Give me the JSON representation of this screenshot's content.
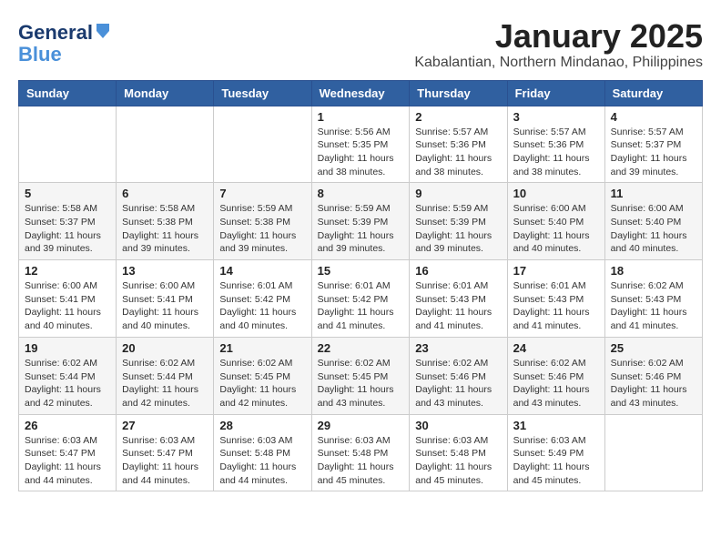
{
  "logo": {
    "line1": "General",
    "line2": "Blue"
  },
  "header": {
    "title": "January 2025",
    "subtitle": "Kabalantian, Northern Mindanao, Philippines"
  },
  "weekdays": [
    "Sunday",
    "Monday",
    "Tuesday",
    "Wednesday",
    "Thursday",
    "Friday",
    "Saturday"
  ],
  "weeks": [
    [
      {
        "day": "",
        "info": ""
      },
      {
        "day": "",
        "info": ""
      },
      {
        "day": "",
        "info": ""
      },
      {
        "day": "1",
        "info": "Sunrise: 5:56 AM\nSunset: 5:35 PM\nDaylight: 11 hours\nand 38 minutes."
      },
      {
        "day": "2",
        "info": "Sunrise: 5:57 AM\nSunset: 5:36 PM\nDaylight: 11 hours\nand 38 minutes."
      },
      {
        "day": "3",
        "info": "Sunrise: 5:57 AM\nSunset: 5:36 PM\nDaylight: 11 hours\nand 38 minutes."
      },
      {
        "day": "4",
        "info": "Sunrise: 5:57 AM\nSunset: 5:37 PM\nDaylight: 11 hours\nand 39 minutes."
      }
    ],
    [
      {
        "day": "5",
        "info": "Sunrise: 5:58 AM\nSunset: 5:37 PM\nDaylight: 11 hours\nand 39 minutes."
      },
      {
        "day": "6",
        "info": "Sunrise: 5:58 AM\nSunset: 5:38 PM\nDaylight: 11 hours\nand 39 minutes."
      },
      {
        "day": "7",
        "info": "Sunrise: 5:59 AM\nSunset: 5:38 PM\nDaylight: 11 hours\nand 39 minutes."
      },
      {
        "day": "8",
        "info": "Sunrise: 5:59 AM\nSunset: 5:39 PM\nDaylight: 11 hours\nand 39 minutes."
      },
      {
        "day": "9",
        "info": "Sunrise: 5:59 AM\nSunset: 5:39 PM\nDaylight: 11 hours\nand 39 minutes."
      },
      {
        "day": "10",
        "info": "Sunrise: 6:00 AM\nSunset: 5:40 PM\nDaylight: 11 hours\nand 40 minutes."
      },
      {
        "day": "11",
        "info": "Sunrise: 6:00 AM\nSunset: 5:40 PM\nDaylight: 11 hours\nand 40 minutes."
      }
    ],
    [
      {
        "day": "12",
        "info": "Sunrise: 6:00 AM\nSunset: 5:41 PM\nDaylight: 11 hours\nand 40 minutes."
      },
      {
        "day": "13",
        "info": "Sunrise: 6:00 AM\nSunset: 5:41 PM\nDaylight: 11 hours\nand 40 minutes."
      },
      {
        "day": "14",
        "info": "Sunrise: 6:01 AM\nSunset: 5:42 PM\nDaylight: 11 hours\nand 40 minutes."
      },
      {
        "day": "15",
        "info": "Sunrise: 6:01 AM\nSunset: 5:42 PM\nDaylight: 11 hours\nand 41 minutes."
      },
      {
        "day": "16",
        "info": "Sunrise: 6:01 AM\nSunset: 5:43 PM\nDaylight: 11 hours\nand 41 minutes."
      },
      {
        "day": "17",
        "info": "Sunrise: 6:01 AM\nSunset: 5:43 PM\nDaylight: 11 hours\nand 41 minutes."
      },
      {
        "day": "18",
        "info": "Sunrise: 6:02 AM\nSunset: 5:43 PM\nDaylight: 11 hours\nand 41 minutes."
      }
    ],
    [
      {
        "day": "19",
        "info": "Sunrise: 6:02 AM\nSunset: 5:44 PM\nDaylight: 11 hours\nand 42 minutes."
      },
      {
        "day": "20",
        "info": "Sunrise: 6:02 AM\nSunset: 5:44 PM\nDaylight: 11 hours\nand 42 minutes."
      },
      {
        "day": "21",
        "info": "Sunrise: 6:02 AM\nSunset: 5:45 PM\nDaylight: 11 hours\nand 42 minutes."
      },
      {
        "day": "22",
        "info": "Sunrise: 6:02 AM\nSunset: 5:45 PM\nDaylight: 11 hours\nand 43 minutes."
      },
      {
        "day": "23",
        "info": "Sunrise: 6:02 AM\nSunset: 5:46 PM\nDaylight: 11 hours\nand 43 minutes."
      },
      {
        "day": "24",
        "info": "Sunrise: 6:02 AM\nSunset: 5:46 PM\nDaylight: 11 hours\nand 43 minutes."
      },
      {
        "day": "25",
        "info": "Sunrise: 6:02 AM\nSunset: 5:46 PM\nDaylight: 11 hours\nand 43 minutes."
      }
    ],
    [
      {
        "day": "26",
        "info": "Sunrise: 6:03 AM\nSunset: 5:47 PM\nDaylight: 11 hours\nand 44 minutes."
      },
      {
        "day": "27",
        "info": "Sunrise: 6:03 AM\nSunset: 5:47 PM\nDaylight: 11 hours\nand 44 minutes."
      },
      {
        "day": "28",
        "info": "Sunrise: 6:03 AM\nSunset: 5:48 PM\nDaylight: 11 hours\nand 44 minutes."
      },
      {
        "day": "29",
        "info": "Sunrise: 6:03 AM\nSunset: 5:48 PM\nDaylight: 11 hours\nand 45 minutes."
      },
      {
        "day": "30",
        "info": "Sunrise: 6:03 AM\nSunset: 5:48 PM\nDaylight: 11 hours\nand 45 minutes."
      },
      {
        "day": "31",
        "info": "Sunrise: 6:03 AM\nSunset: 5:49 PM\nDaylight: 11 hours\nand 45 minutes."
      },
      {
        "day": "",
        "info": ""
      }
    ]
  ]
}
